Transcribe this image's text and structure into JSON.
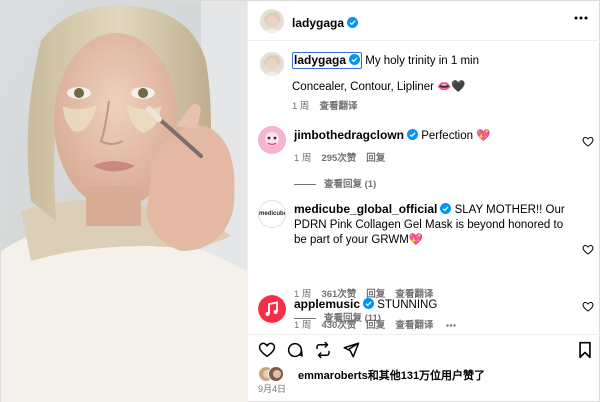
{
  "post": {
    "author": "ladygaga",
    "caption_author": "ladygaga",
    "caption_title": "My holy trinity in 1 min",
    "caption_body": "Concealer, Contour, Lipliner 👄🖤",
    "caption_time": "1 周",
    "caption_translate": "查看翻译",
    "likes_text_user": "emmaroberts",
    "likes_text_rest": "和其他131万位用户赞了",
    "date": "9月4日"
  },
  "comments": [
    {
      "username": "jimbothedragclown",
      "text": "Perfection 💖",
      "time": "1 周",
      "likes": "295次赞",
      "reply": "回复",
      "view_replies": "查看回复 (1)"
    },
    {
      "username": "medicube_global_official",
      "text": "SLAY MOTHER!! Our PDRN Pink Collagen Gel Mask is beyond honored to be part of your GRWM💖",
      "time": "1 周",
      "likes": "361次赞",
      "reply": "回复",
      "translate": "查看翻译",
      "view_replies": "查看回复 (11)",
      "avatar_label": "medicube"
    },
    {
      "username": "applemusic",
      "text": "STUNNING",
      "time": "1 周",
      "likes": "430次赞",
      "reply": "回复",
      "translate": "查看翻译"
    }
  ],
  "icons": {
    "verified": "verified-badge-icon",
    "more": "more-options-icon",
    "like": "heart-icon",
    "comment": "comment-icon",
    "share": "share-icon",
    "save": "bookmark-icon"
  },
  "colors": {
    "verified": "#0095f6",
    "muted": "#737373",
    "highlight_box": "#3b6fd6",
    "applemusic": "#fa2d48"
  }
}
